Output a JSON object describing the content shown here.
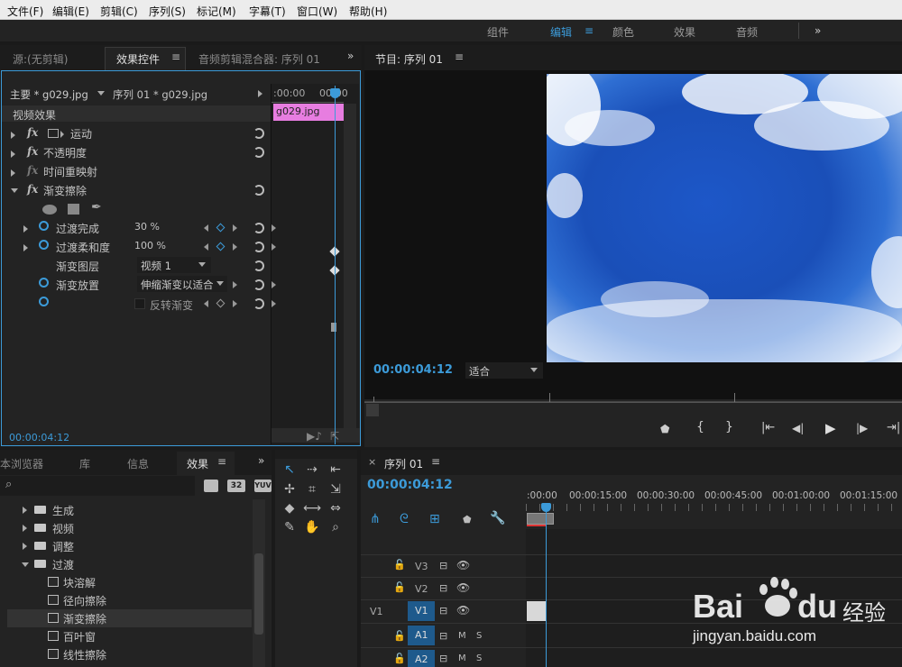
{
  "menu": [
    "文件(F)",
    "编辑(E)",
    "剪辑(C)",
    "序列(S)",
    "标记(M)",
    "字幕(T)",
    "窗口(W)",
    "帮助(H)"
  ],
  "workspaces": {
    "w1": "组件",
    "w2": "编辑",
    "w3": "颜色",
    "w4": "效果",
    "w5": "音频",
    "more": "»"
  },
  "src": {
    "tab_source": "源:(无剪辑)",
    "tab_effects": "效果控件",
    "tab_mixer": "音频剪辑混合器: 序列 01",
    "menu": "≡",
    "more": "»",
    "master": "主要 * g029.jpg",
    "seq": "序列 01 * g029.jpg",
    "t0": ":00:00",
    "t1": "00:00",
    "clip": "g029.jpg",
    "video_effects": "视频效果",
    "motion": "运动",
    "opacity": "不透明度",
    "time_remap": "时间重映射",
    "gradient_wipe": "渐变擦除",
    "fx": "fx",
    "p1": "过渡完成",
    "v1": "30 %",
    "p2": "过渡柔和度",
    "v2": "100 %",
    "p3": "渐变图层",
    "v3": "视频 1",
    "p4": "渐变放置",
    "v4": "伸缩渐变以适合",
    "p5": "反转渐变",
    "timecode": "00:00:04:12"
  },
  "program": {
    "title": "节目: 序列 01",
    "menu": "≡",
    "timecode": "00:00:04:12",
    "fit": "适合"
  },
  "project": {
    "tab_browser": "本浏览器",
    "tab_lib": "库",
    "tab_info": "信息",
    "tab_effects": "效果",
    "menu": "≡",
    "more": "»",
    "b32": "32",
    "byuv": "YUV",
    "items": [
      "生成",
      "视频",
      "调整",
      "过渡",
      "块溶解",
      "径向擦除",
      "渐变擦除",
      "百叶窗",
      "线性擦除"
    ]
  },
  "timeline": {
    "close": "×",
    "title": "序列 01",
    "menu": "≡",
    "timecode": "00:00:04:12",
    "ruler": [
      ":00:00",
      "00:00:15:00",
      "00:00:30:00",
      "00:00:45:00",
      "00:01:00:00",
      "00:01:15:00"
    ],
    "tracks": {
      "v3": "V3",
      "v2": "V2",
      "v1": "V1",
      "v1src": "V1",
      "a1": "A1",
      "a2": "A2",
      "m": "M",
      "s": "S"
    }
  },
  "watermark": {
    "brand": "Bai",
    "brand2": "du",
    "cn": "经验",
    "url": "jingyan.baidu.com"
  },
  "colors": {
    "accent": "#3c9bd9",
    "clip_pink": "#e77de0",
    "sky": "#1e5fcf"
  }
}
